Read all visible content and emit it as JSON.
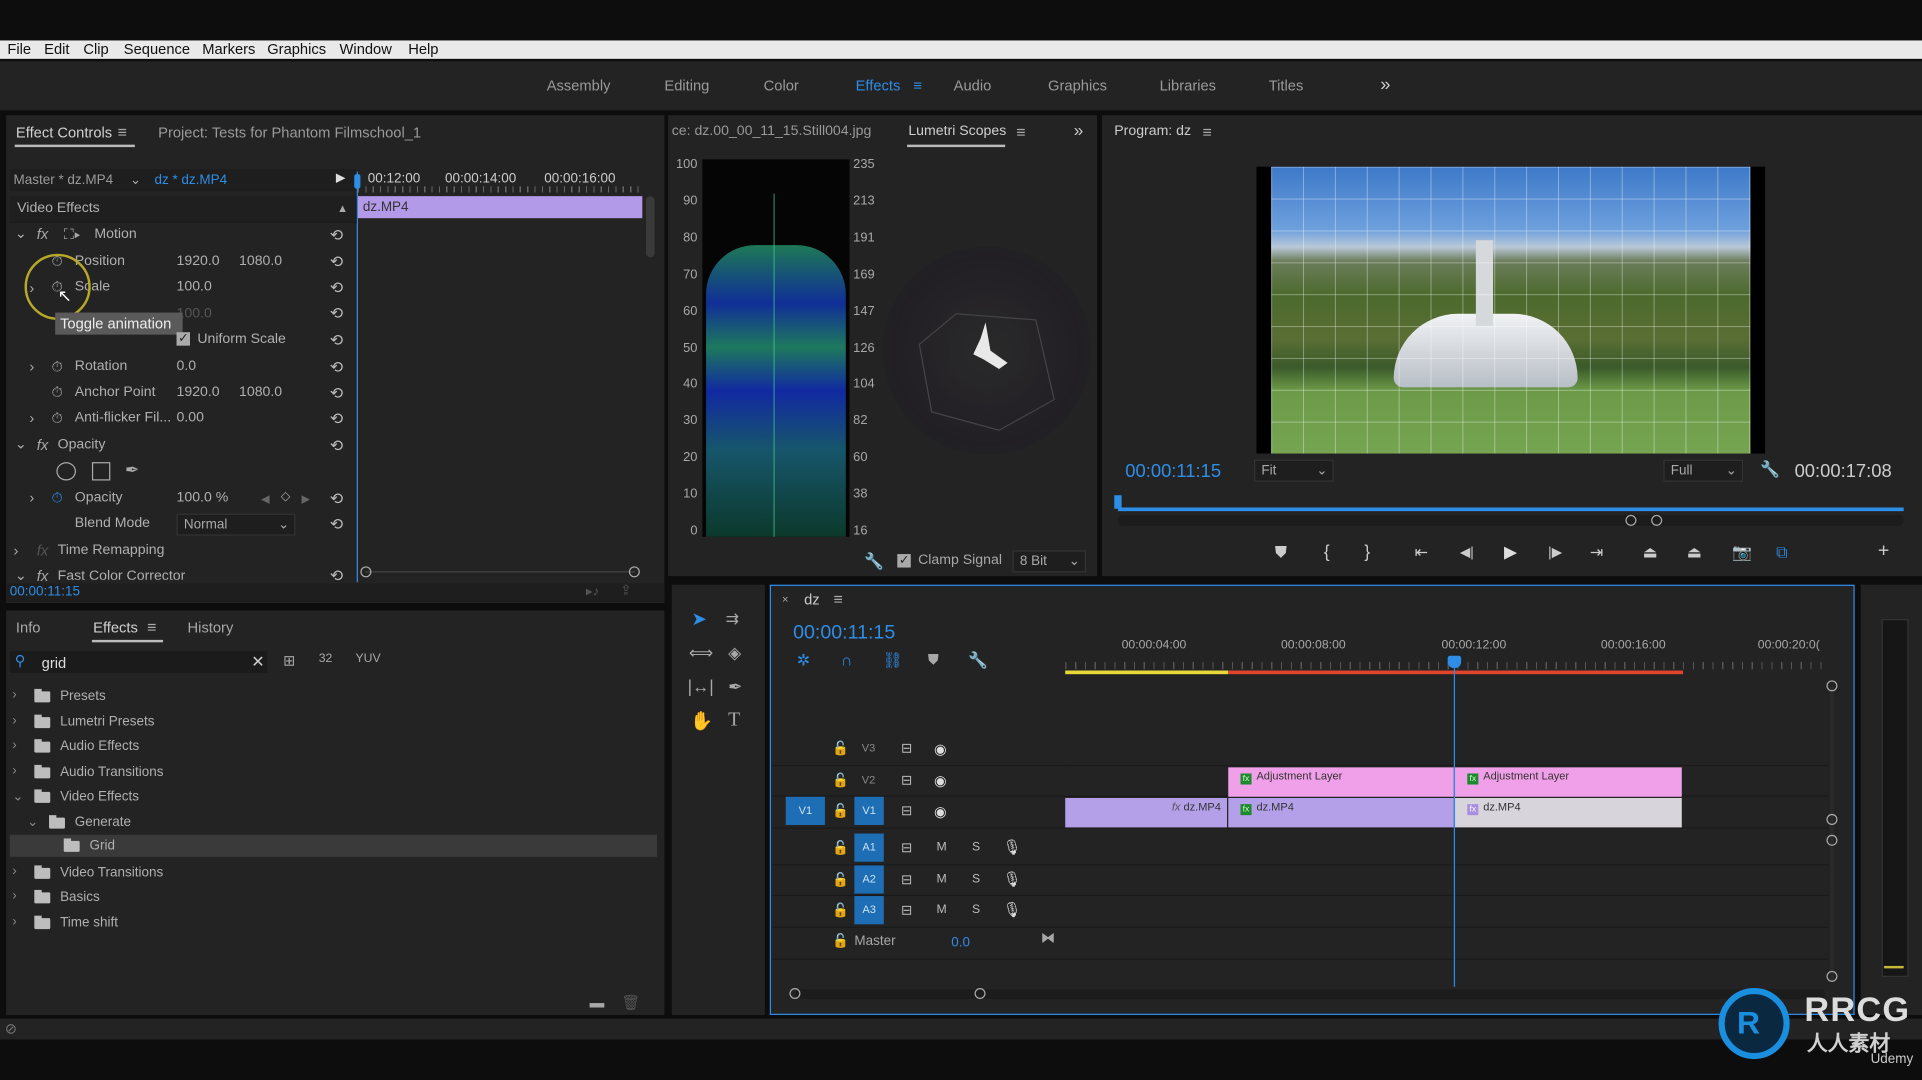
{
  "menu": [
    "File",
    "Edit",
    "Clip",
    "Sequence",
    "Markers",
    "Graphics",
    "Window",
    "Help"
  ],
  "workspaces": {
    "items": [
      "Assembly",
      "Editing",
      "Color",
      "Effects",
      "Audio",
      "Graphics",
      "Libraries",
      "Titles"
    ],
    "active": "Effects",
    "overflow": "»"
  },
  "effect_controls": {
    "tab": "Effect Controls",
    "project_tab": "Project: Tests for Phantom Filmschool_1",
    "master_clip": "Master * dz.MP4",
    "sequence_clip": "dz * dz.MP4",
    "ruler": [
      "00:12:00",
      "00:00:14:00",
      "00:00:16:00"
    ],
    "clip_bar": "dz.MP4",
    "section": "Video Effects",
    "motion": "Motion",
    "position": {
      "label": "Position",
      "x": "1920.0",
      "y": "1080.0"
    },
    "scale": {
      "label": "Scale",
      "value": "100.0"
    },
    "scale_width": {
      "value": "100.0"
    },
    "tooltip": "Toggle animation",
    "uniform_scale": "Uniform Scale",
    "rotation": {
      "label": "Rotation",
      "value": "0.0"
    },
    "anchor": {
      "label": "Anchor Point",
      "x": "1920.0",
      "y": "1080.0"
    },
    "antiflicker": {
      "label": "Anti-flicker Fil...",
      "value": "0.00"
    },
    "opacity_header": "Opacity",
    "opacity": {
      "label": "Opacity",
      "value": "100.0 %"
    },
    "blend": {
      "label": "Blend Mode",
      "value": "Normal"
    },
    "time_remap": "Time Remapping",
    "fcc": "Fast Color Corrector",
    "timecode": "00:00:11:15"
  },
  "effects_panel": {
    "tabs": [
      "Info",
      "Effects",
      "History"
    ],
    "active": "Effects",
    "search": "grid",
    "tree": [
      {
        "label": "Presets",
        "level": 0
      },
      {
        "label": "Lumetri Presets",
        "level": 0
      },
      {
        "label": "Audio Effects",
        "level": 0
      },
      {
        "label": "Audio Transitions",
        "level": 0
      },
      {
        "label": "Video Effects",
        "level": 0,
        "expanded": true
      },
      {
        "label": "Generate",
        "level": 1,
        "expanded": true
      },
      {
        "label": "Grid",
        "level": 2,
        "selected": true
      },
      {
        "label": "Video Transitions",
        "level": 0
      },
      {
        "label": "Basics",
        "level": 0
      },
      {
        "label": "Time shift",
        "level": 0
      }
    ]
  },
  "scopes": {
    "source_tab": "ce: dz.00_00_11_15.Still004.jpg",
    "tab": "Lumetri Scopes",
    "left_scale": [
      "100",
      "90",
      "80",
      "70",
      "60",
      "50",
      "40",
      "30",
      "20",
      "10",
      "0"
    ],
    "right_scale": [
      "235",
      "213",
      "191",
      "169",
      "147",
      "126",
      "104",
      "82",
      "60",
      "38",
      "16"
    ],
    "clamp_signal": "Clamp Signal",
    "clamp_checked": true,
    "bit_depth": "8 Bit"
  },
  "program": {
    "title": "Program: dz",
    "timecode": "00:00:11:15",
    "zoom": "Fit",
    "quality": "Full",
    "duration": "00:00:17:08"
  },
  "timeline": {
    "sequence": "dz",
    "timecode": "00:00:11:15",
    "ruler": [
      "00:00:04:00",
      "00:00:08:00",
      "00:00:12:00",
      "00:00:16:00",
      "00:00:20:0("
    ],
    "tracks": {
      "v3": "V3",
      "v2": "V2",
      "v1": "V1",
      "src_v1": "V1",
      "a1": "A1",
      "a2": "A2",
      "a3": "A3",
      "mute": "M",
      "solo": "S"
    },
    "master": {
      "label": "Master",
      "value": "0.0"
    },
    "clips": {
      "adj1": "Adjustment Layer",
      "adj2": "Adjustment Layer",
      "v1a": "dz.MP4",
      "v1b": "dz.MP4",
      "v1c": "dz.MP4"
    }
  },
  "watermark": {
    "brand": "RRCG",
    "sub": "人人素材",
    "udemy": "Udemy"
  },
  "colors": {
    "accent": "#2e8de6",
    "clip_video": "#b3a0e8",
    "clip_adjustment": "#f0a0e8",
    "clip_selected": "#d8d4dc",
    "workarea_rendered": "#e8d83a",
    "workarea_unrendered": "#e0442c"
  }
}
